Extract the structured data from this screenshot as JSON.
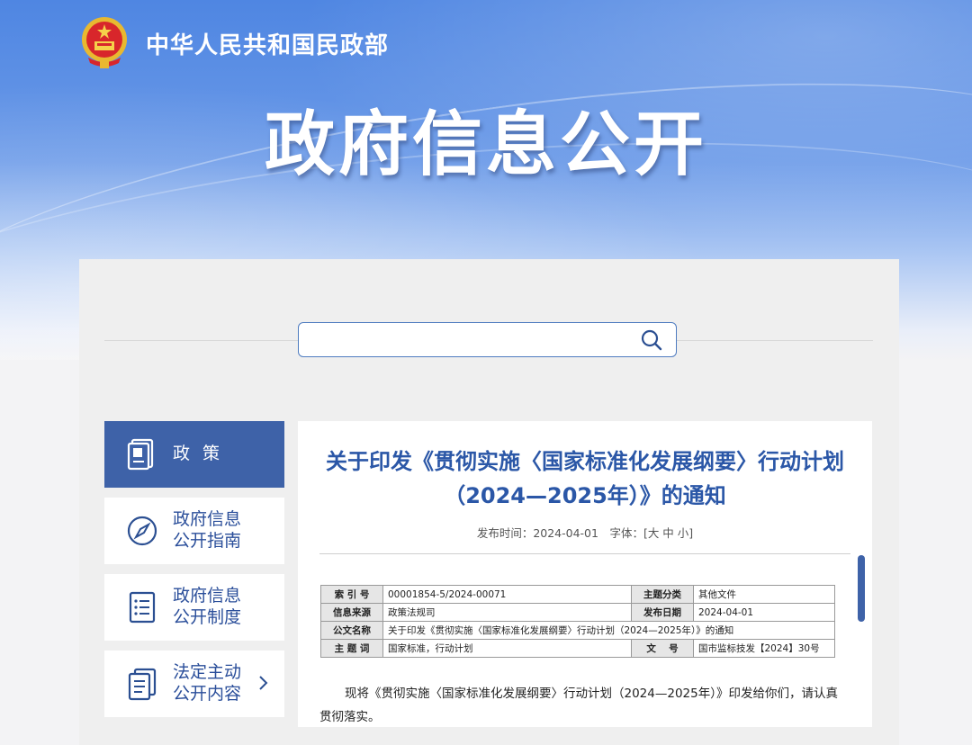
{
  "header": {
    "org_name": "中华人民共和国民政部",
    "page_title": "政府信息公开"
  },
  "search": {
    "placeholder": ""
  },
  "sidebar": {
    "items": [
      {
        "label": "政策",
        "icon": "book-icon",
        "active": true
      },
      {
        "label_line1": "政府信息",
        "label_line2": "公开指南",
        "icon": "compass-icon"
      },
      {
        "label_line1": "政府信息",
        "label_line2": "公开制度",
        "icon": "list-document-icon"
      },
      {
        "label_line1": "法定主动",
        "label_line2": "公开内容",
        "icon": "documents-icon"
      }
    ]
  },
  "document": {
    "title": "关于印发《贯彻实施〈国家标准化发展纲要〉行动计划（2024—2025年）》的通知",
    "meta": "发布时间：2024-04-01　字体：[大 中 小]",
    "info": {
      "index_label": "索 引 号",
      "index_value": "00001854-5/2024-00071",
      "topic_label": "主题分类",
      "topic_value": "其他文件",
      "source_label": "信息来源",
      "source_value": "政策法规司",
      "date_label": "发布日期",
      "date_value": "2024-04-01",
      "name_label": "公文名称",
      "name_value": "关于印发《贯彻实施〈国家标准化发展纲要〉行动计划（2024—2025年）》的通知",
      "keywords_label": "主 题 词",
      "keywords_value": "国家标准，行动计划",
      "docno_label": "文　 号",
      "docno_value": "国市监标技发【2024】30号"
    },
    "body": "现将《贯彻实施〈国家标准化发展纲要〉行动计划（2024—2025年）》印发给你们，请认真贯彻落实。"
  },
  "colors": {
    "accent": "#3e62a8",
    "title_blue": "#2b57a7"
  }
}
